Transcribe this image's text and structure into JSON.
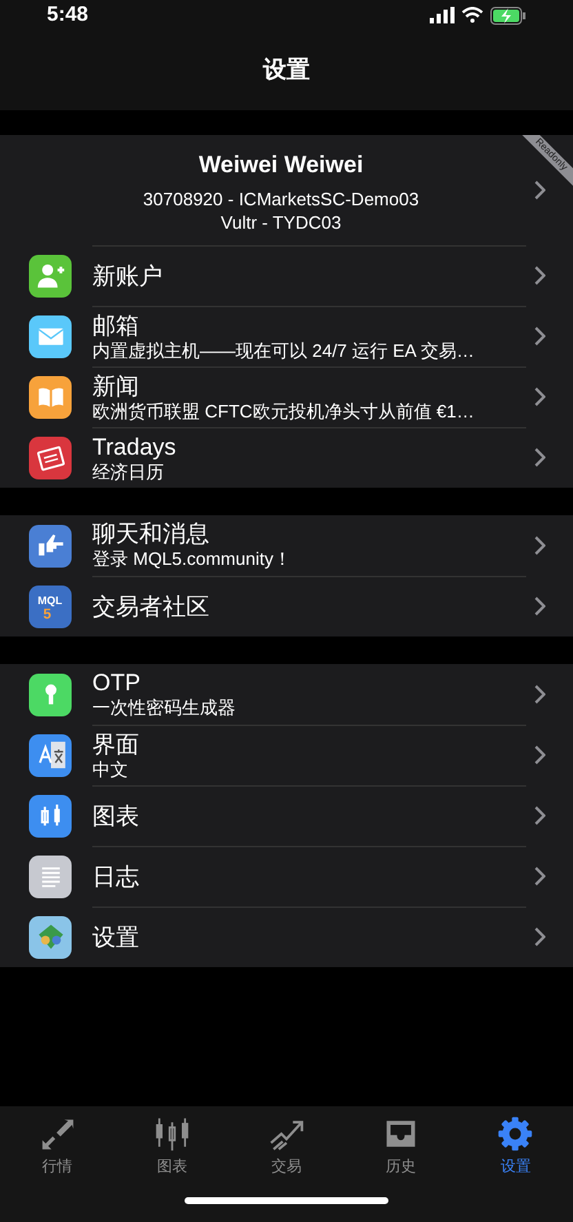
{
  "status_bar": {
    "time": "5:48"
  },
  "nav": {
    "title": "设置"
  },
  "account": {
    "name": "Weiwei Weiwei",
    "line_1": "30708920 - ICMarketsSC-Demo03",
    "line_2": "Vultr - TYDC03",
    "ribbon": "Readonly"
  },
  "sections": [
    {
      "items": [
        {
          "title": "新账户",
          "color": "#5ac33a"
        },
        {
          "title": "邮箱",
          "subtitle": "内置虚拟主机——现在可以 24/7 运行 EA 交易…",
          "color": "#5ac8fa"
        },
        {
          "title": "新闻",
          "subtitle": "欧洲货币联盟  CFTC欧元投机净头寸从前值 €1…",
          "color": "#f7a23b"
        },
        {
          "title": "Tradays",
          "subtitle": "经济日历",
          "color": "#d9363e"
        }
      ]
    },
    {
      "items": [
        {
          "title": "聊天和消息",
          "subtitle": "登录 MQL5.community！",
          "color": "#4a7fd4"
        },
        {
          "title": "交易者社区",
          "color": "#3b6fc4",
          "icon_text": "MQL",
          "icon_digit": "5"
        }
      ]
    },
    {
      "items": [
        {
          "title": "OTP",
          "subtitle": "一次性密码生成器",
          "color": "#4cd964"
        },
        {
          "title": "界面",
          "subtitle": "中文",
          "color": "#3d8ef0"
        },
        {
          "title": "图表",
          "color": "#3d8ef0"
        },
        {
          "title": "日志",
          "color": "#c7c9d0"
        },
        {
          "title": "设置",
          "color": "#8ac4e8"
        }
      ]
    }
  ],
  "tabs": [
    {
      "label": "行情",
      "selected": false
    },
    {
      "label": "图表",
      "selected": false
    },
    {
      "label": "交易",
      "selected": false
    },
    {
      "label": "历史",
      "selected": false
    },
    {
      "label": "设置",
      "selected": true
    }
  ]
}
